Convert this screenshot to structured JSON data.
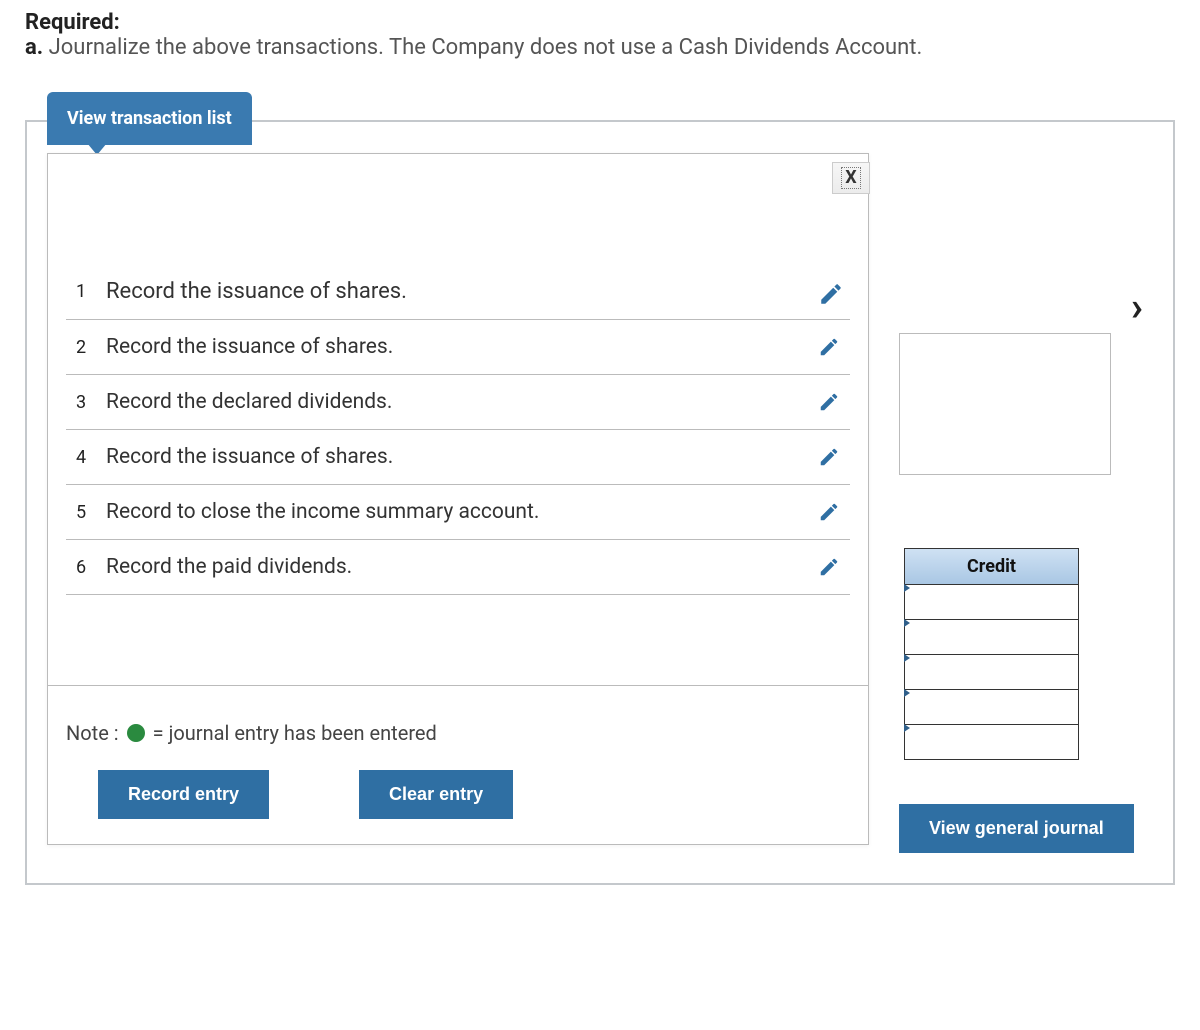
{
  "header": {
    "required_label": "Required:",
    "prompt_prefix": "a.",
    "prompt_text": "Journalize the above transactions. The Company does not use a Cash Dividends Account."
  },
  "tab_label": "View transaction list",
  "transactions": [
    {
      "n": "1",
      "label": "Record the issuance of shares."
    },
    {
      "n": "2",
      "label": "Record the issuance of shares."
    },
    {
      "n": "3",
      "label": "Record the declared dividends."
    },
    {
      "n": "4",
      "label": "Record the issuance of shares."
    },
    {
      "n": "5",
      "label": "Record to close the income summary account."
    },
    {
      "n": "6",
      "label": "Record the paid dividends."
    }
  ],
  "note": {
    "prefix": "Note :",
    "text": "= journal entry has been entered"
  },
  "buttons": {
    "record": "Record entry",
    "clear": "Clear entry",
    "view_journal": "View general journal"
  },
  "side": {
    "credit_header": "Credit",
    "close_x": "X"
  }
}
